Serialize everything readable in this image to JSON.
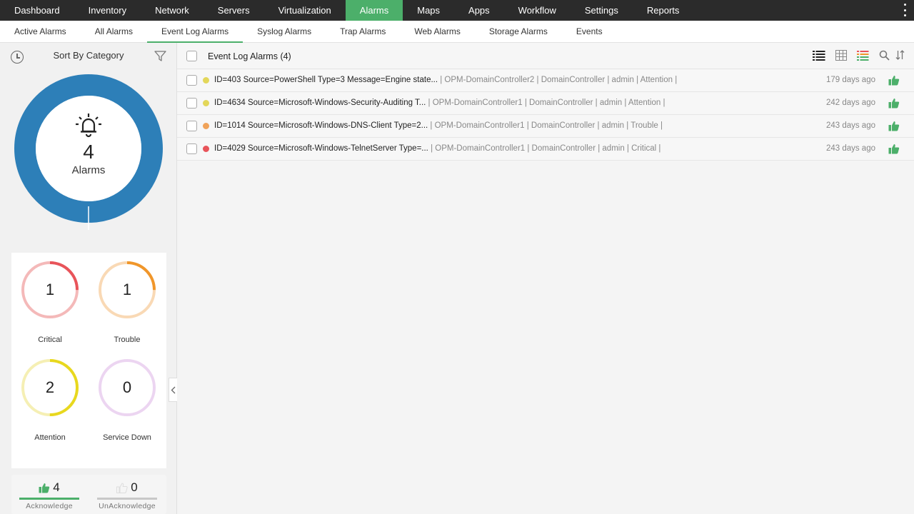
{
  "topnav": {
    "items": [
      {
        "label": "Dashboard",
        "active": false
      },
      {
        "label": "Inventory",
        "active": false
      },
      {
        "label": "Network",
        "active": false
      },
      {
        "label": "Servers",
        "active": false
      },
      {
        "label": "Virtualization",
        "active": false
      },
      {
        "label": "Alarms",
        "active": true
      },
      {
        "label": "Maps",
        "active": false
      },
      {
        "label": "Apps",
        "active": false
      },
      {
        "label": "Workflow",
        "active": false
      },
      {
        "label": "Settings",
        "active": false
      },
      {
        "label": "Reports",
        "active": false
      }
    ]
  },
  "subnav": {
    "items": [
      {
        "label": "Active Alarms",
        "active": false
      },
      {
        "label": "All Alarms",
        "active": false
      },
      {
        "label": "Event Log Alarms",
        "active": true
      },
      {
        "label": "Syslog Alarms",
        "active": false
      },
      {
        "label": "Trap Alarms",
        "active": false
      },
      {
        "label": "Web Alarms",
        "active": false
      },
      {
        "label": "Storage Alarms",
        "active": false
      },
      {
        "label": "Events",
        "active": false
      }
    ]
  },
  "sidebar": {
    "sort_label": "Sort By Category",
    "total": {
      "count": "4",
      "label": "Alarms"
    },
    "severities": [
      {
        "label": "Critical",
        "count": "1",
        "color": "#e8545a",
        "track": "#f4b9b9"
      },
      {
        "label": "Trouble",
        "count": "1",
        "color": "#f0962a",
        "track": "#f9d9b5"
      },
      {
        "label": "Attention",
        "count": "2",
        "color": "#e8d81e",
        "track": "#f5efb4"
      },
      {
        "label": "Service Down",
        "count": "0",
        "color": "#c990d6",
        "track": "#ecd5f1"
      }
    ],
    "acknowledge": {
      "count": "4",
      "label": "Acknowledge",
      "color": "#4caf6a"
    },
    "unacknowledge": {
      "count": "0",
      "label": "UnAcknowledge",
      "color": "#c8c8c8"
    }
  },
  "main": {
    "title": "Event Log Alarms (4)",
    "rows": [
      {
        "message": "ID=403 Source=PowerShell Type=3 Message=Engine state...",
        "meta": " | OPM-DomainController2 | DomainController | admin | Attention |",
        "time": "179 days ago",
        "severity_color": "#e3d75a"
      },
      {
        "message": "ID=4634 Source=Microsoft-Windows-Security-Auditing T...",
        "meta": " | OPM-DomainController1 | DomainController | admin | Attention |",
        "time": "242 days ago",
        "severity_color": "#e3d75a"
      },
      {
        "message": "ID=1014 Source=Microsoft-Windows-DNS-Client Type=2...",
        "meta": " | OPM-DomainController1 | DomainController | admin | Trouble |",
        "time": "243 days ago",
        "severity_color": "#f0a35a"
      },
      {
        "message": "ID=4029 Source=Microsoft-Windows-TelnetServer Type=...",
        "meta": " | OPM-DomainController1 | DomainController | admin | Critical |",
        "time": "243 days ago",
        "severity_color": "#e8545a"
      }
    ]
  },
  "colors": {
    "accent": "#4caf6a",
    "donut": "#2d7fb8",
    "topnav_bg": "#2b2b2b"
  }
}
